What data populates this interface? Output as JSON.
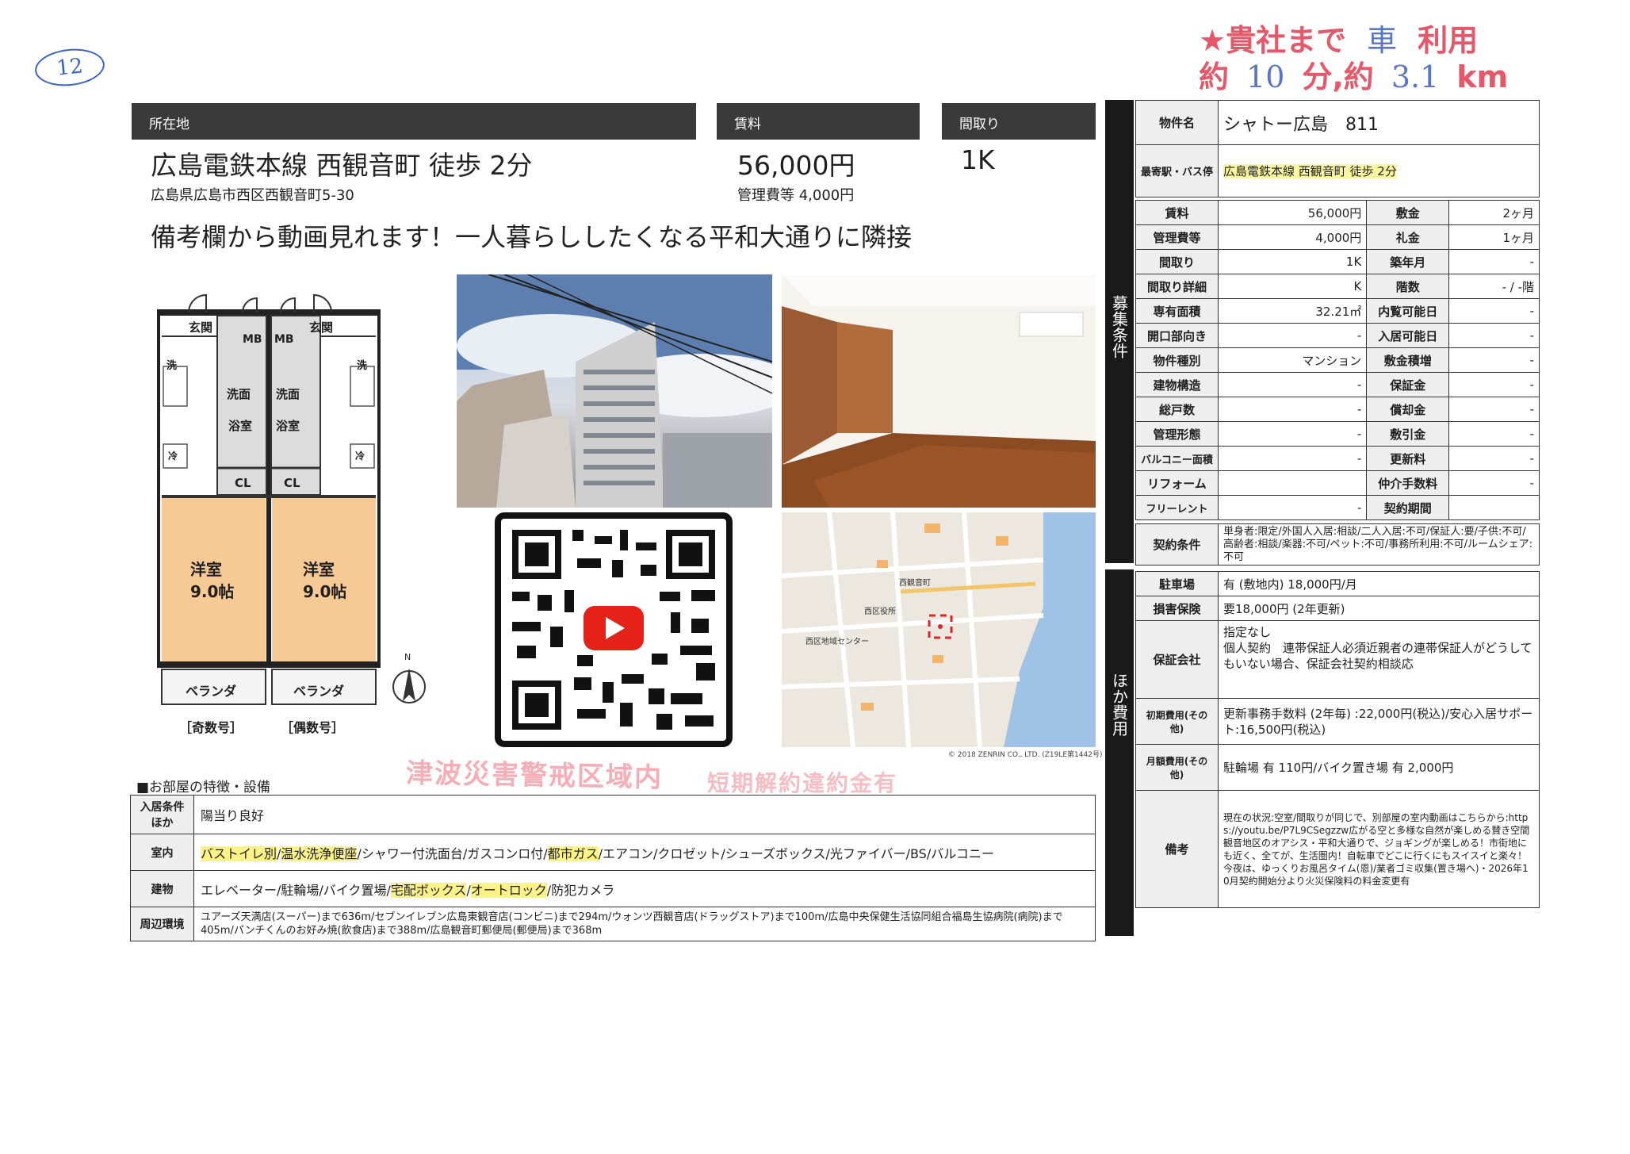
{
  "marks": {
    "circle_number": "12",
    "top_stamp_line1": "★貴社まで",
    "top_stamp_vehicle": "車",
    "top_stamp_use": "利用",
    "top_stamp_line2_a": "約",
    "top_stamp_min_value": "10",
    "top_stamp_min_unit": "分,約",
    "top_stamp_km_value": "3.1",
    "top_stamp_km_unit": "km",
    "tsunami_stamp": "津波災害警戒区域内",
    "stamp2": "短期解約違約金有"
  },
  "header": {
    "location_label": "所在地",
    "rent_label": "賃料",
    "layout_label": "間取り"
  },
  "summary": {
    "access": "広島電鉄本線 西観音町 徒歩 2分",
    "address": "広島県広島市西区西観音町5-30",
    "rent": "56,000円",
    "mgmt_fee": "管理費等 4,000円",
    "layout": "1K",
    "headline": "備考欄から動画見れます！一人暮らししたくなる平和大通りに隣接"
  },
  "floorplan": {
    "genkan": "玄関",
    "mb": "MB",
    "sen": "洗",
    "senmen": "洗面",
    "yokushitsu": "浴室",
    "rei": "冷",
    "cl": "CL",
    "room": "洋室",
    "room_size": "9.0帖",
    "veranda": "ベランダ",
    "odd": "［奇数号］",
    "even": "［偶数号］",
    "north": "N"
  },
  "map": {
    "copyright": "© 2018 ZENRIN CO., LTD. (Z19LE第1442号)",
    "label_ward": "西区役所",
    "label_center": "西区地域センター",
    "label_station": "西観音町"
  },
  "info": {
    "bands": {
      "recruit": "募集条件",
      "other": "ほか費用"
    },
    "name_label": "物件名",
    "name_value": "シャトー広島　811",
    "station_label": "最寄駅・バス停",
    "station_value": "広島電鉄本線 西観音町 徒歩 2分",
    "rows": [
      {
        "k1": "賃料",
        "v1": "56,000円",
        "k2": "敷金",
        "v2": "2ヶ月"
      },
      {
        "k1": "管理費等",
        "v1": "4,000円",
        "k2": "礼金",
        "v2": "1ヶ月"
      },
      {
        "k1": "間取り",
        "v1": "1K",
        "k2": "築年月",
        "v2": "-"
      },
      {
        "k1": "間取り詳細",
        "v1": "K",
        "k2": "階数",
        "v2": "- / -階"
      },
      {
        "k1": "専有面積",
        "v1": "32.21㎡",
        "k2": "内覧可能日",
        "v2": "-"
      },
      {
        "k1": "開口部向き",
        "v1": "-",
        "k2": "入居可能日",
        "v2": "-"
      },
      {
        "k1": "物件種別",
        "v1": "マンション",
        "k2": "敷金積増",
        "v2": "-"
      },
      {
        "k1": "建物構造",
        "v1": "-",
        "k2": "保証金",
        "v2": "-"
      },
      {
        "k1": "総戸数",
        "v1": "-",
        "k2": "償却金",
        "v2": "-"
      },
      {
        "k1": "管理形態",
        "v1": "-",
        "k2": "敷引金",
        "v2": "-"
      },
      {
        "k1": "バルコニー面積",
        "v1": "-",
        "k2": "更新料",
        "v2": "-"
      },
      {
        "k1": "リフォーム",
        "v1": "",
        "k2": "仲介手数料",
        "v2": "-"
      },
      {
        "k1": "フリーレント",
        "v1": "-",
        "k2": "契約期間",
        "v2": ""
      }
    ],
    "contract_label": "契約条件",
    "contract_value": "単身者:限定/外国人入居:相談/二人入居:不可/保証人:要/子供:不可/高齢者:相談/楽器:不可/ペット:不可/事務所利用:不可/ルームシェア:不可",
    "parking_label": "駐車場",
    "parking_value": "有 (敷地内) 18,000円/月",
    "insurance_label": "損害保険",
    "insurance_value": "要18,000円 (2年更新)",
    "guarantor_label": "保証会社",
    "guarantor_value": "指定なし\n個人契約　連帯保証人必須近親者の連帯保証人がどうしてもいない場合、保証会社契約相談応",
    "initial_label": "初期費用(その他)",
    "initial_value": "更新事務手数料 (2年毎) :22,000円(税込)/安心入居サポート:16,500円(税込)",
    "monthly_label": "月額費用(その他)",
    "monthly_value": "駐輪場 有 110円/バイク置き場 有 2,000円",
    "remarks_label": "備考",
    "remarks_value": "現在の状況:空室/間取りが同じで、別部屋の室内動画はこちらから:https://youtu.be/P7L9CSegzzw広がる空と多様な自然が楽しめる賛き空間観音地区のオアシス・平和大通りで、ジョギングが楽しめる！市街地にも近く、全てが、生活圏内！自転車でどこに行くにもスイスイと楽々！今夜は、ゆっくりお風呂タイム(恩)/業者ゴミ収集(置き場へ)・2026年10月契約開始分より火災保険料の料金変更有"
  },
  "features": {
    "title": "■お部屋の特徴・設備",
    "rows": [
      {
        "k": "入居条件ほか",
        "segments": [
          {
            "t": "陽当り良好",
            "h": false
          }
        ]
      },
      {
        "k": "室内",
        "segments": [
          {
            "t": "バストイレ別",
            "h": true
          },
          {
            "t": "/",
            "h": false
          },
          {
            "t": "温水洗浄便座",
            "h": true
          },
          {
            "t": "/シャワー付洗面台/ガスコンロ付/",
            "h": false
          },
          {
            "t": "都市ガス",
            "h": true
          },
          {
            "t": "/エアコン/クロゼット/シューズボックス/光ファイバー/BS/バルコニー",
            "h": false
          }
        ]
      },
      {
        "k": "建物",
        "segments": [
          {
            "t": "エレベーター/駐輪場/バイク置場/",
            "h": false
          },
          {
            "t": "宅配ボックス",
            "h": true
          },
          {
            "t": "/",
            "h": false
          },
          {
            "t": "オートロック",
            "h": true
          },
          {
            "t": "/防犯カメラ",
            "h": false
          }
        ]
      },
      {
        "k": "周辺環境",
        "segments": [
          {
            "t": "ユアーズ天満店(スーパー)まで636m/セブンイレブン広島東観音店(コンビニ)まで294m/ウォンツ西観音店(ドラッグストア)まで100m/広島中央保健生活協同組合福島生協病院(病院)まで405m/パンチくんのお好み焼(飲食店)まで388m/広島観音町郵便局(郵便局)まで368m",
            "h": false
          }
        ]
      }
    ]
  },
  "colors": {
    "highlight": "#fbf38a",
    "stamp_red": "#e23b4f",
    "header_dark": "#3a3a3a"
  }
}
